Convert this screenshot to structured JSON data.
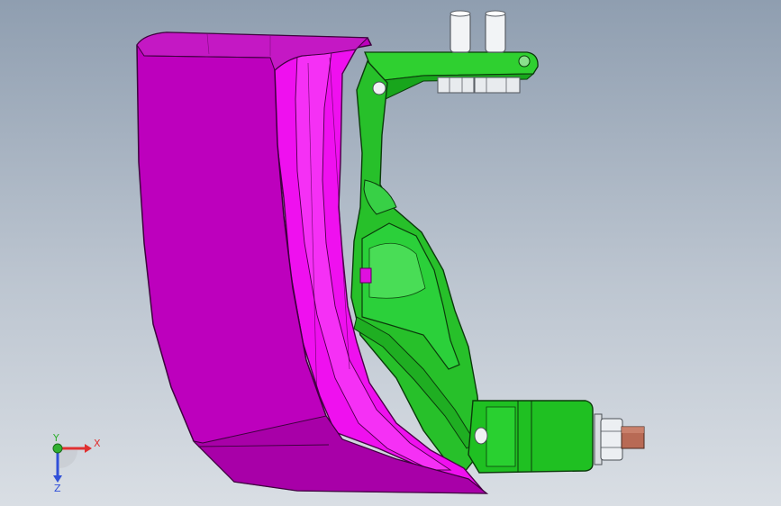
{
  "viewport": {
    "background_top": "#8f9eb0",
    "background_bottom": "#d9dee4"
  },
  "model": {
    "parts": [
      {
        "name": "fender-shell",
        "color": "#bd00bd"
      },
      {
        "name": "fender-flange",
        "color": "#ef10ef"
      },
      {
        "name": "bracket-body",
        "color": "#27c02a"
      },
      {
        "name": "bracket-pad",
        "color": "#2bd03a"
      },
      {
        "name": "mount-sleeve",
        "color": "#1fb521"
      },
      {
        "name": "stud-bolts",
        "color": "#f2f4f6"
      },
      {
        "name": "axle-pin",
        "color": "#b86a55"
      }
    ]
  },
  "triad": {
    "x_label": "X",
    "y_label": "Y",
    "z_label": "Z",
    "x_color": "#e03030",
    "y_color": "#30b030",
    "z_color": "#3050d8"
  }
}
